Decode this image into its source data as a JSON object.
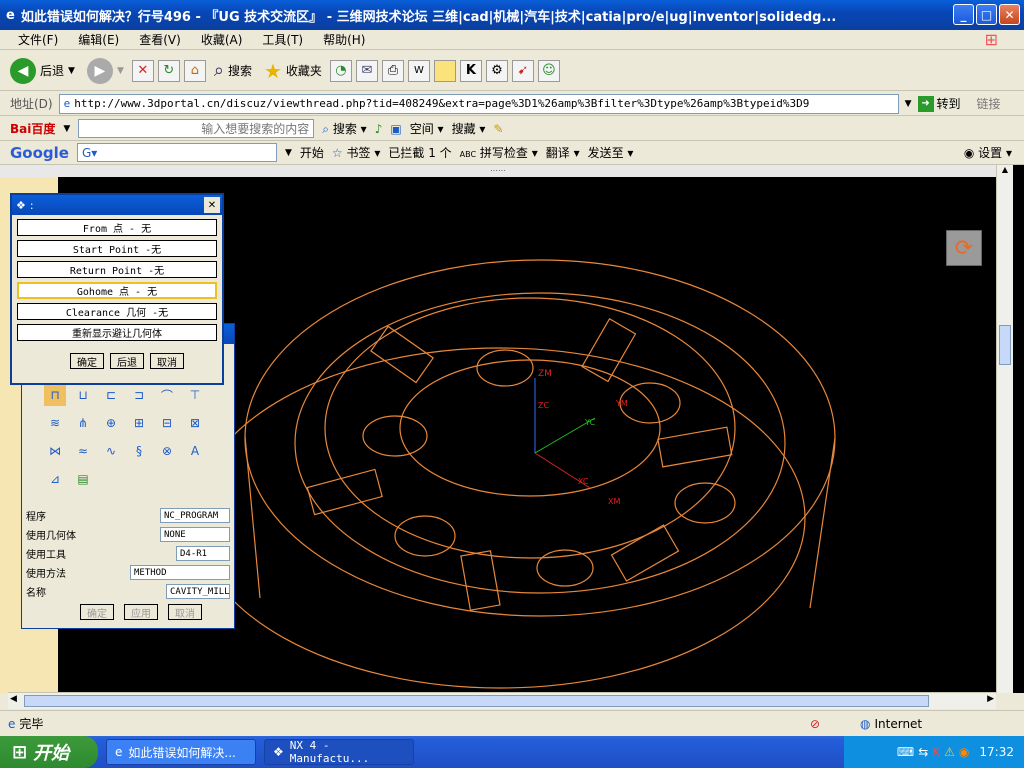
{
  "window": {
    "title": "如此错误如何解决？行号496 - 『UG 技术交流区』 - 三维网技术论坛 三维|cad|机械|汽车|技术|catia|pro/e|ug|inventor|solidedg...",
    "min": "_",
    "max": "□",
    "close": "✕"
  },
  "menu": [
    "文件(F)",
    "编辑(E)",
    "查看(V)",
    "收藏(A)",
    "工具(T)",
    "帮助(H)"
  ],
  "toolbar": {
    "back": "后退",
    "search": "搜索",
    "favorites": "收藏夹"
  },
  "address": {
    "label": "地址(D)",
    "url": "http://www.3dportal.cn/discuz/viewthread.php?tid=408249&extra=page%3D1%26amp%3Bfilter%3Dtype%26amp%3Btypeid%3D9",
    "go": "转到",
    "links": "链接"
  },
  "baidu": {
    "logo": "Bai百度",
    "placeholder": "输入想要搜索的内容",
    "search": "搜索",
    "space": "空间",
    "collect": "搜藏"
  },
  "google": {
    "logo": "Google",
    "start": "开始",
    "bookmarks": "书签",
    "blocked": "已拦截 1 个",
    "spellcheck": "拼写检查",
    "translate": "翻译",
    "sendto": "发送至",
    "settings": "设置"
  },
  "content": {
    "top_text": "……"
  },
  "point_dialog": {
    "title": ":",
    "items": [
      "From 点 - 无",
      "Start Point -无",
      "Return Point -无",
      "Gohome 点 - 无",
      "Clearance 几何 -无",
      "重新显示避让几何体"
    ],
    "ok": "确定",
    "back": "后退",
    "cancel": "取消"
  },
  "op_dialog": {
    "fields": [
      {
        "label": "程序",
        "value": "NC_PROGRAM"
      },
      {
        "label": "使用几何体",
        "value": "NONE"
      },
      {
        "label": "使用工具",
        "value": "D4-R1"
      },
      {
        "label": "使用方法",
        "value": "METHOD"
      },
      {
        "label": "名称",
        "value": "CAVITY_MILL"
      }
    ],
    "ok": "确定",
    "apply": "应用",
    "cancel": "取消"
  },
  "axis_labels": {
    "zm": "ZM",
    "zc": "ZC",
    "ym": "YM",
    "yc": "YC",
    "xc": "XC",
    "xm": "XM"
  },
  "status": {
    "text": "完毕",
    "zone": "Internet"
  },
  "taskbar": {
    "start": "开始",
    "tasks": [
      "如此错误如何解决...",
      "NX 4 - Manufactu..."
    ],
    "time": "17:32"
  },
  "colors": {
    "model": "#e8873a",
    "xp_blue": "#0a5fd8"
  }
}
